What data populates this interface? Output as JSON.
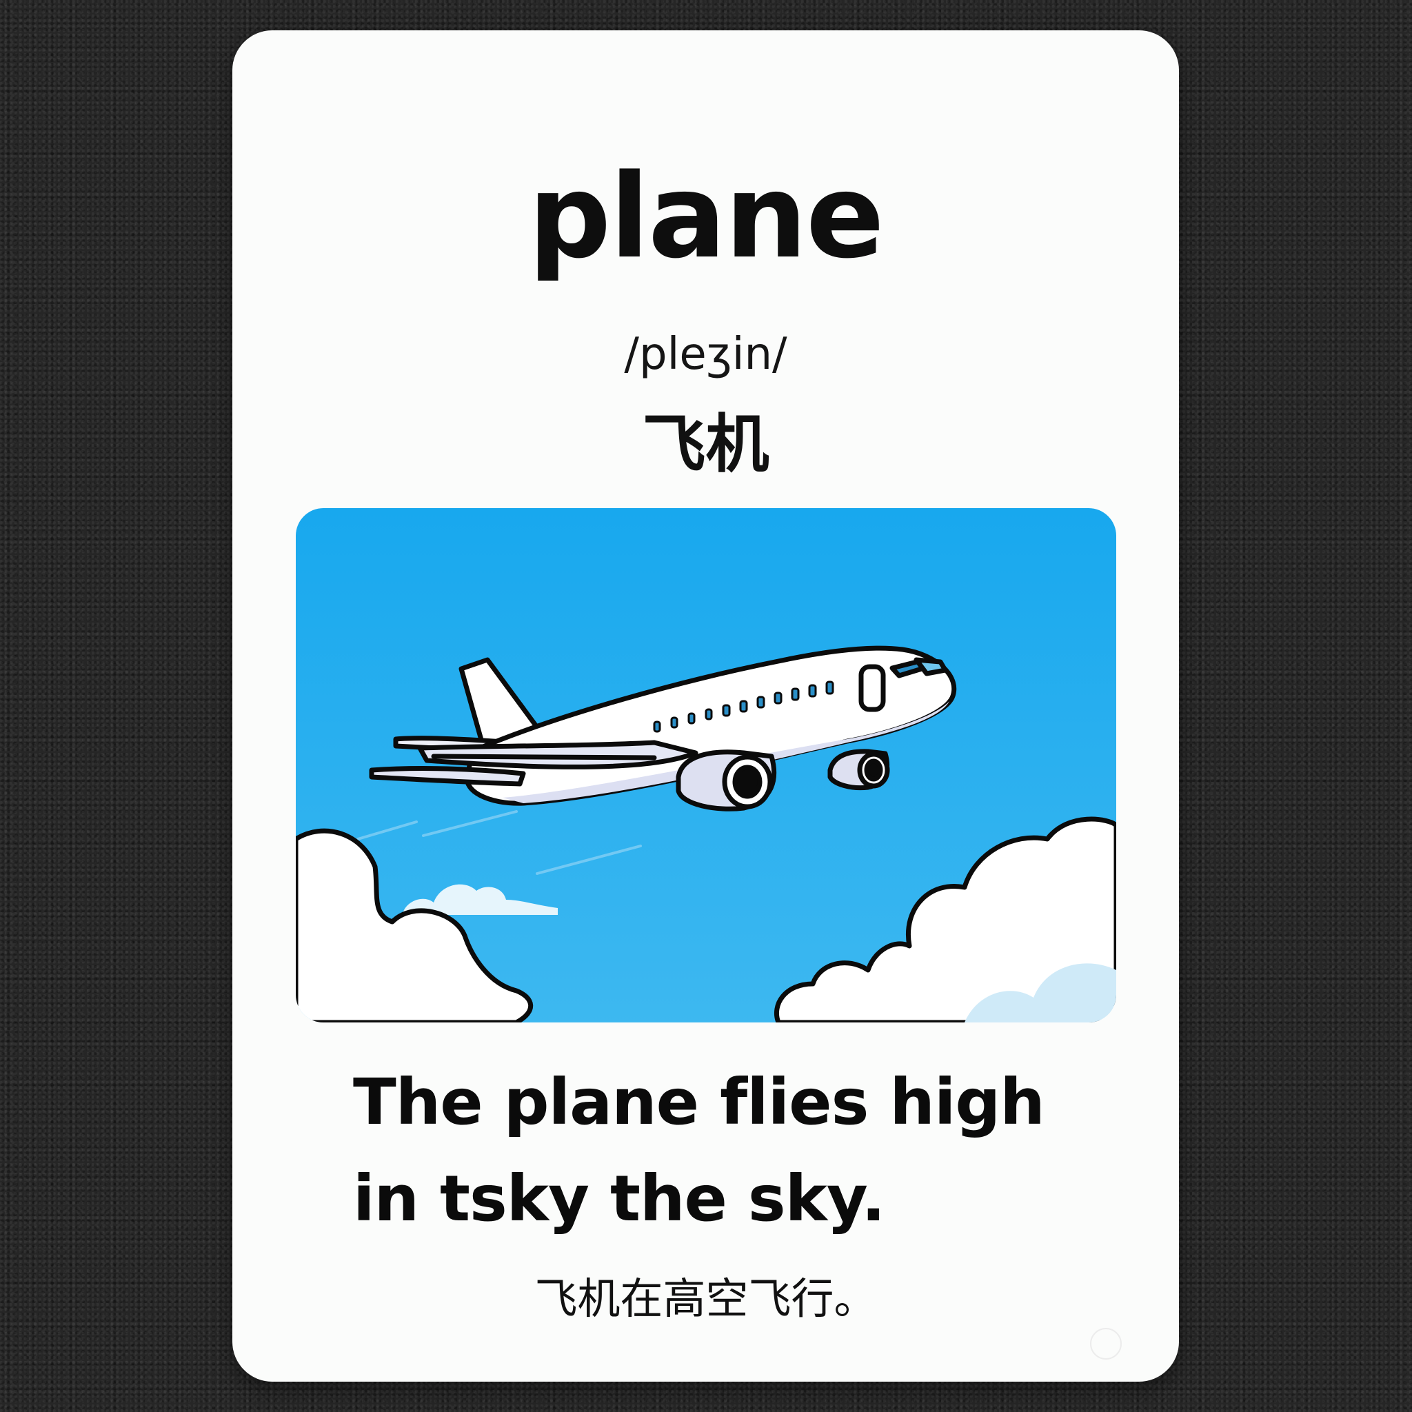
{
  "card": {
    "word": "plane",
    "ipa": "/pleʒin/",
    "translation": "飞机",
    "sentence_line1": "The plane flies high",
    "sentence_line2": "in tsky the sky.",
    "sentence_translation": "飞机在高空飞行。"
  },
  "illustration": {
    "subject": "airplane-icon",
    "colors": {
      "sky": "#1fa9ec",
      "cloud_fill": "#ffffff",
      "distant_cloud": "#d4eefa",
      "plane_body": "#ffffff",
      "plane_shade": "#dcdff2",
      "window": "#2a8fc8",
      "outline": "#0b0b0b"
    }
  }
}
